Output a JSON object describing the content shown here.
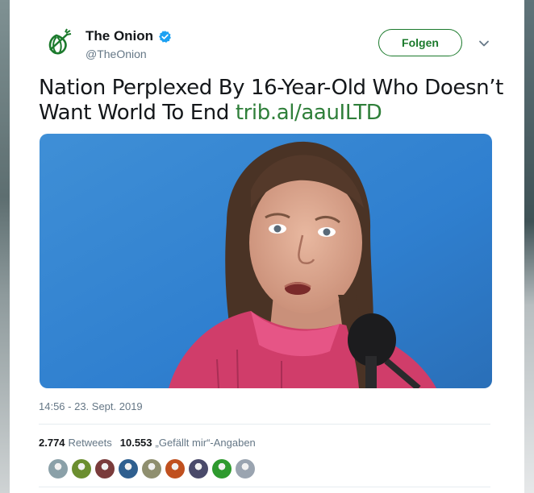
{
  "tweet": {
    "author_name": "The Onion",
    "handle": "@TheOnion",
    "follow_label": "Folgen",
    "text": "Nation Perplexed By 16-Year-Old Who Doesn’t Want World To End ",
    "link": "trib.al/aauILTD",
    "timestamp": "14:56 - 23. Sept. 2019"
  },
  "stats": {
    "retweets_count": "2.774",
    "retweets_label": "Retweets",
    "likes_count": "10.553",
    "likes_label": "„Gefällt mir“-Angaben"
  },
  "icons": {
    "logo": "onion-logo-icon",
    "verified": "verified-badge-icon",
    "menu": "chevron-down-icon"
  },
  "colors": {
    "brand_green": "#1b7a2c",
    "link_green": "#2f7f3a",
    "verified_blue": "#1da1f2",
    "muted": "#657786"
  },
  "likers": [
    {
      "name": "liker-avatar-1",
      "color": "#8aa0a8"
    },
    {
      "name": "liker-avatar-2",
      "color": "#6b8e2f"
    },
    {
      "name": "liker-avatar-3",
      "color": "#7a3b3b"
    },
    {
      "name": "liker-avatar-4",
      "color": "#2f5f8f"
    },
    {
      "name": "liker-avatar-5",
      "color": "#8f8f6f"
    },
    {
      "name": "liker-avatar-6",
      "color": "#c0501f"
    },
    {
      "name": "liker-avatar-7",
      "color": "#4a4a6a"
    },
    {
      "name": "liker-avatar-8",
      "color": "#2e9a2e"
    },
    {
      "name": "liker-avatar-9",
      "color": "#9aa4b0"
    }
  ]
}
